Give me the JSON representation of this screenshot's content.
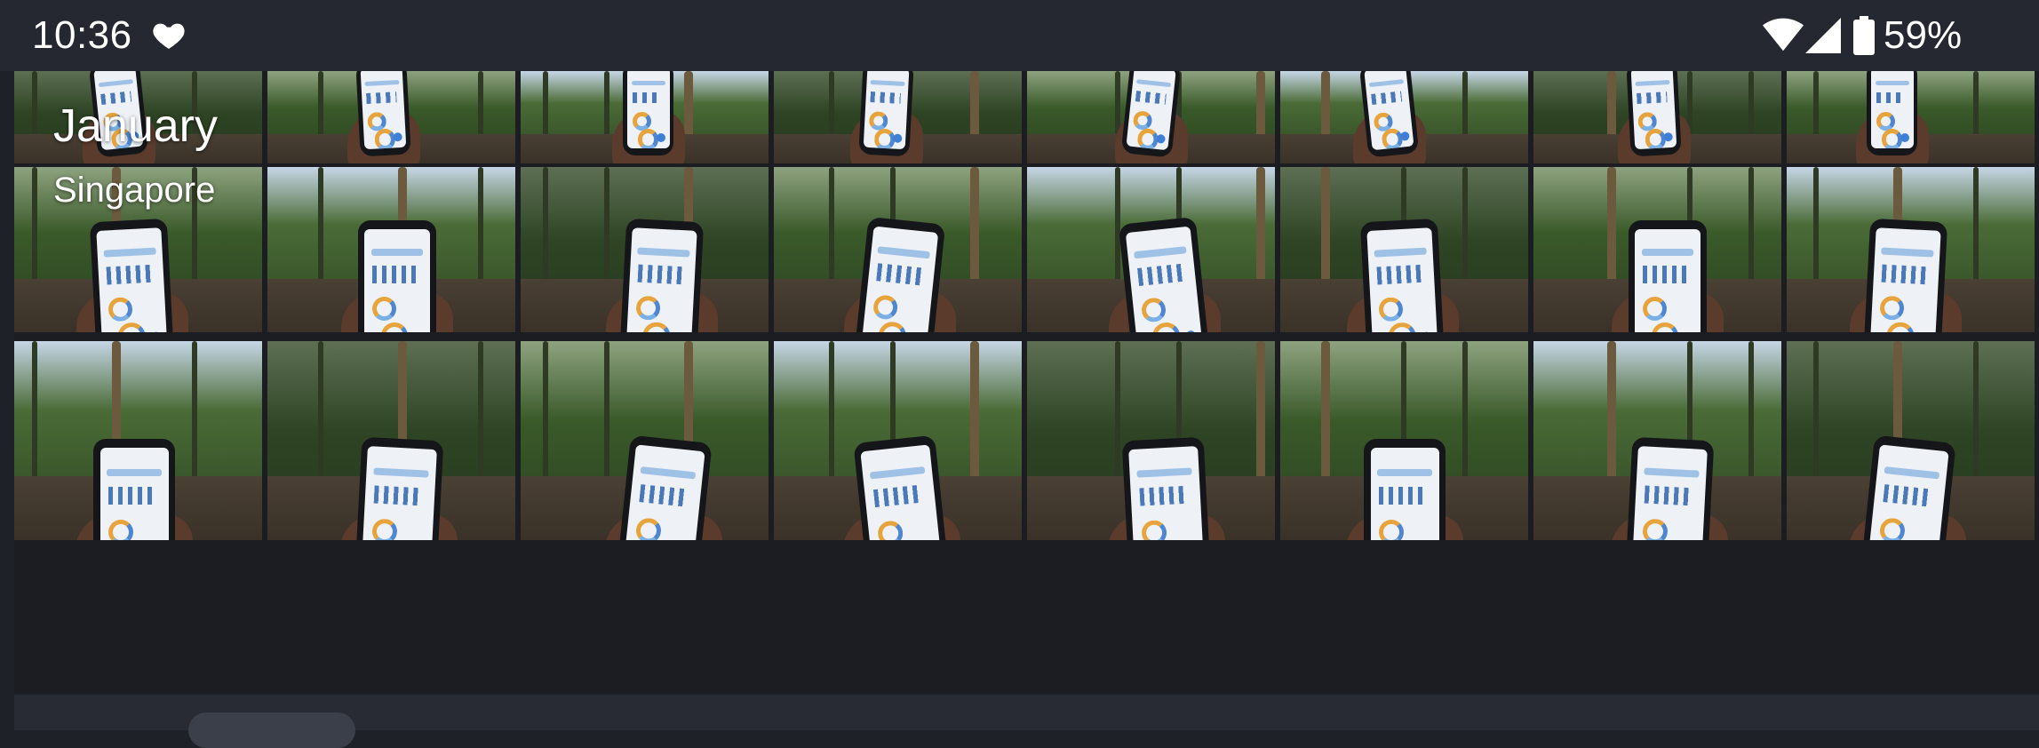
{
  "status_bar": {
    "time": "10:36",
    "battery_percent": "59%",
    "icons": [
      "heart-icon",
      "wifi-icon",
      "cell-signal-icon",
      "battery-icon"
    ]
  },
  "album_header": {
    "month": "January",
    "location": "Singapore"
  },
  "grid": {
    "rows": 3,
    "columns": 8,
    "photo_count_visible": 24
  },
  "colors": {
    "status_bar_bg": "#252830",
    "background": "#1f2128",
    "foliage": "#2f4a22",
    "phone_screen": "#eef2f7",
    "accent_blue": "#3f7fd5"
  }
}
